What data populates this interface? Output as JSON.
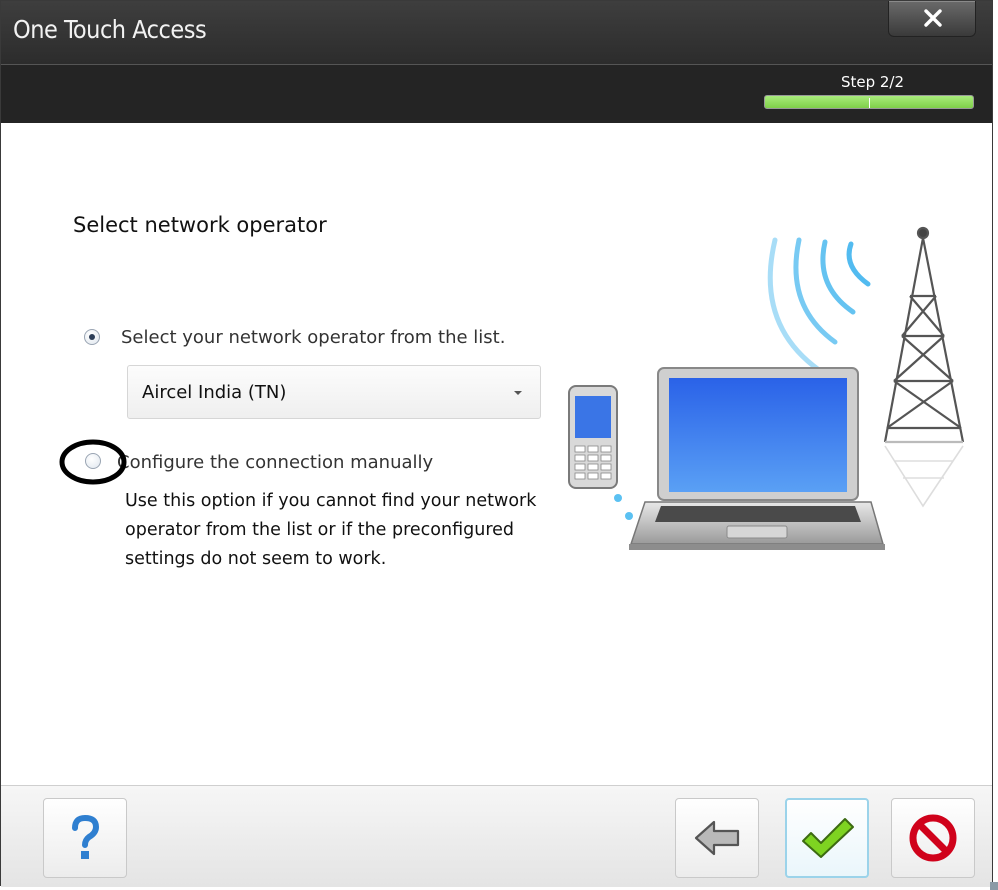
{
  "window": {
    "title": "One Touch Access",
    "close_icon": "close-x-icon"
  },
  "wizard": {
    "step_label": "Step 2/2",
    "progress_fraction": 1.0,
    "progress_color": "#8fdc5c"
  },
  "content": {
    "heading": "Select network operator",
    "option_list": {
      "label": "Select your network operator from the list.",
      "selected": true
    },
    "operator_select": {
      "value": "Aircel India (TN)"
    },
    "option_manual": {
      "label": "Configure the connection manually",
      "selected": false
    },
    "manual_help": "Use this option if you cannot find your network operator from the list or if the preconfigured settings do not seem to work."
  },
  "illustration": {
    "description_icon": "laptop-phone-tower-illustration"
  },
  "footer": {
    "help_icon": "question-mark-icon",
    "back_icon": "back-arrow-icon",
    "finish_icon": "checkmark-icon",
    "cancel_icon": "cancel-icon"
  }
}
